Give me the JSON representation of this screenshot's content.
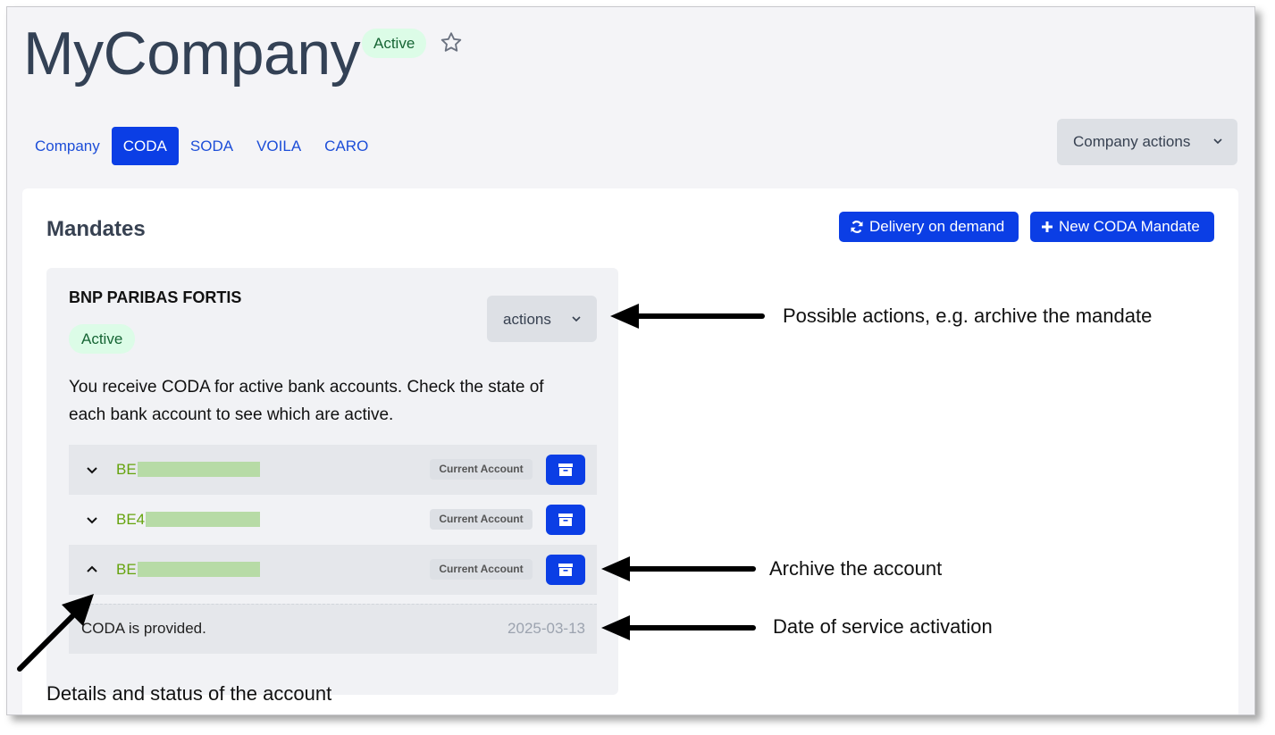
{
  "header": {
    "title": "MyCompany",
    "status_badge": "Active",
    "favorite_icon": "star-outline-icon"
  },
  "tabs": [
    {
      "label": "Company",
      "active": false
    },
    {
      "label": "CODA",
      "active": true
    },
    {
      "label": "SODA",
      "active": false
    },
    {
      "label": "VOILA",
      "active": false
    },
    {
      "label": "CARO",
      "active": false
    }
  ],
  "company_actions_label": "Company actions",
  "mandates": {
    "title": "Mandates",
    "delivery_button": "Delivery on demand",
    "new_button": "New CODA Mandate",
    "card": {
      "bank_name": "BNP PARIBAS FORTIS",
      "status": "Active",
      "actions_label": "actions",
      "description": "You receive CODA for active bank accounts. Check the state of each bank account to see which are active.",
      "accounts": [
        {
          "iban_prefix": "BE",
          "type": "Current Account",
          "expanded": false
        },
        {
          "iban_prefix": "BE4",
          "type": "Current Account",
          "expanded": false
        },
        {
          "iban_prefix": "BE",
          "type": "Current Account",
          "expanded": true
        }
      ],
      "detail": {
        "status_text": "CODA is provided.",
        "date": "2025-03-13"
      }
    }
  },
  "annotations": {
    "actions": "Possible actions, e.g. archive the mandate",
    "archive": "Archive the account",
    "date": "Date of service activation",
    "details": "Details and status of the account"
  },
  "colors": {
    "primary": "#0b3ee5",
    "badge_bg": "#dcfce7",
    "badge_text": "#166534",
    "iban_text": "#65a30d"
  }
}
